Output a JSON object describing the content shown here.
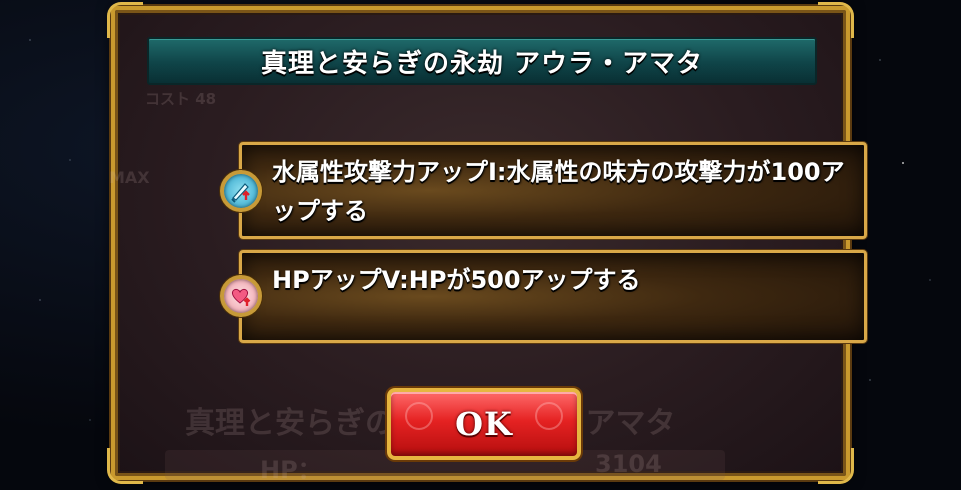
{
  "dialog": {
    "title": "真理と安らぎの永劫 アウラ・アマタ",
    "abilities": [
      {
        "icon": "attack-up-icon",
        "text": "水属性攻撃力アップI:水属性の味方の攻撃力が100アップする"
      },
      {
        "icon": "hp-up-icon",
        "text": "HPアップV:HPが500アップする"
      }
    ],
    "ok_label": "OK"
  },
  "background_card": {
    "cost_label": "コスト 48",
    "max_label": "MAX",
    "name": "真理と安らぎの永劫 アウラ・アマタ",
    "hp_label": "HP：",
    "hp_value": "3104"
  },
  "colors": {
    "frame_gold": "#c99a2e",
    "title_teal": "#0f4448",
    "button_red": "#e52222"
  }
}
